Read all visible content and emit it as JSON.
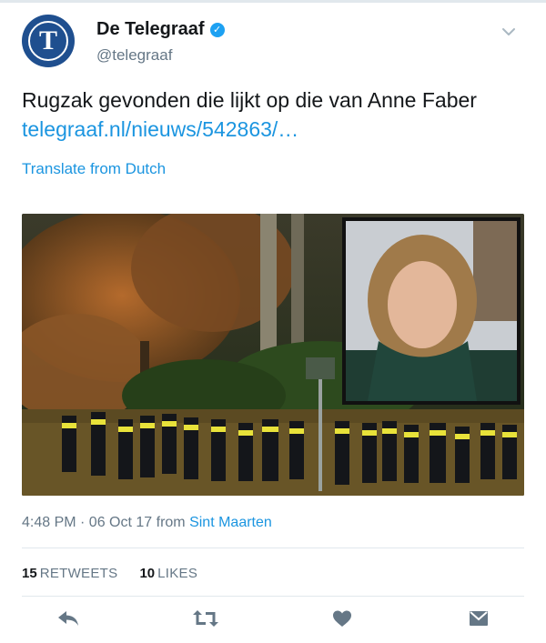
{
  "account": {
    "display_name": "De Telegraaf",
    "handle": "@telegraaf",
    "avatar_letter": "T",
    "verified_icon": "verified-check-icon"
  },
  "tweet": {
    "text": "Rugzak gevonden die lijkt op die van Anne Faber",
    "link": "telegraaf.nl/nieuws/542863/…",
    "translate": "Translate from Dutch"
  },
  "meta": {
    "time_date": "4:48 PM · 06 Oct 17 from ",
    "place": "Sint Maarten"
  },
  "stats": {
    "retweets_count": "15",
    "retweets_label": "RETWEETS",
    "likes_count": "10",
    "likes_label": "LIKES"
  },
  "actions": [
    "reply-icon",
    "retweet-icon",
    "like-icon",
    "message-icon"
  ],
  "colors": {
    "link_blue": "#1b95e0",
    "verified_blue": "#1da1f2",
    "muted_gray": "#657786",
    "icon_gray": "#657786",
    "avatar_blue": "#1f4f8f"
  }
}
